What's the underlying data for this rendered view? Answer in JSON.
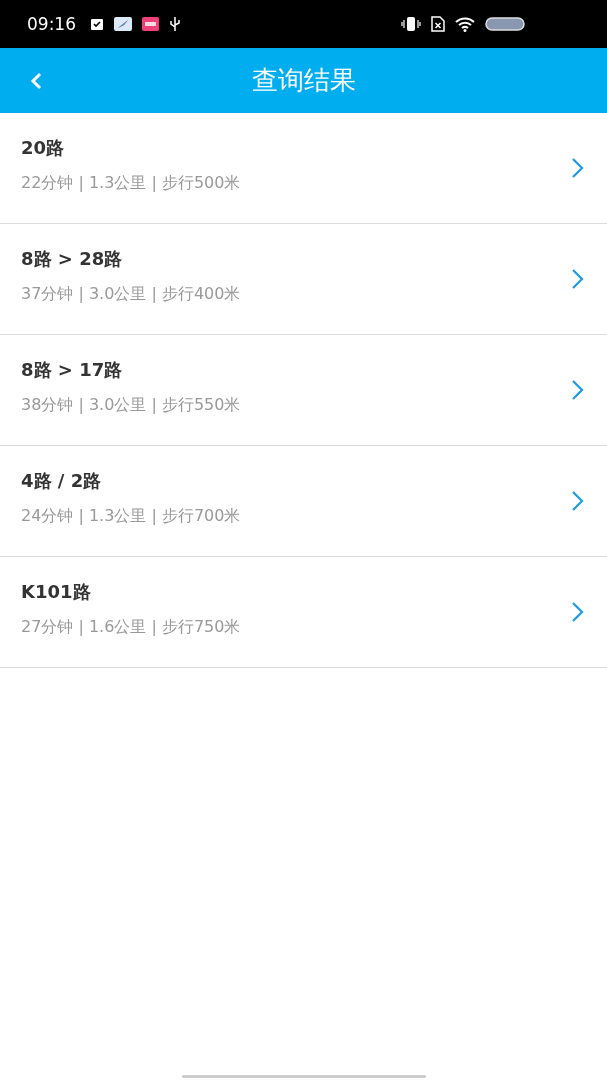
{
  "status_bar": {
    "time": "09:16"
  },
  "header": {
    "title": "查询结果"
  },
  "routes": [
    {
      "name": "20路",
      "details": "22分钟 | 1.3公里 | 步行500米"
    },
    {
      "name": "8路 > 28路",
      "details": "37分钟 | 3.0公里 | 步行400米"
    },
    {
      "name": "8路 > 17路",
      "details": "38分钟 | 3.0公里 | 步行550米"
    },
    {
      "name": "4路 / 2路",
      "details": "24分钟 | 1.3公里 | 步行700米"
    },
    {
      "name": "K101路",
      "details": "27分钟 | 1.6公里 | 步行750米"
    }
  ]
}
